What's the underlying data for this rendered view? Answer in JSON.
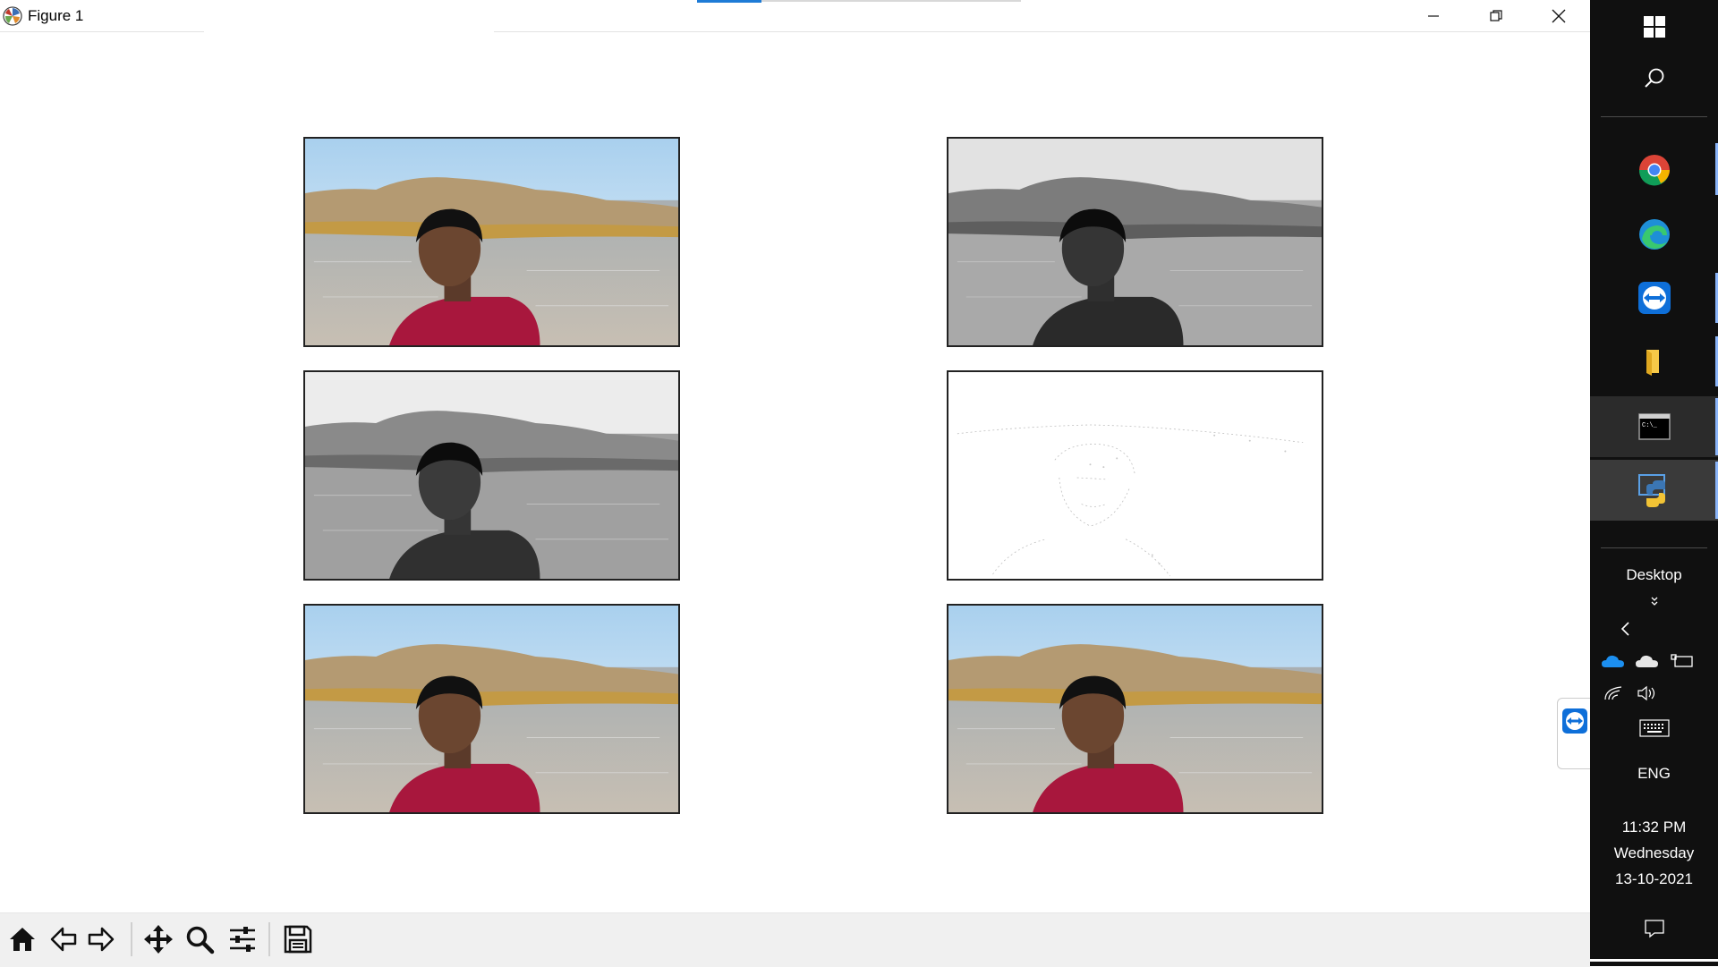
{
  "window": {
    "title": "Figure 1",
    "controls": [
      "minimize",
      "restore",
      "close"
    ]
  },
  "figure": {
    "panels": [
      {
        "name": "original-color-image",
        "style": "color"
      },
      {
        "name": "grayscale-image",
        "style": "gray"
      },
      {
        "name": "grayscale-image-2",
        "style": "gray2"
      },
      {
        "name": "edge-detection-image",
        "style": "edges"
      },
      {
        "name": "color-image-3",
        "style": "color"
      },
      {
        "name": "color-image-4",
        "style": "color"
      }
    ]
  },
  "toolbar": {
    "buttons": [
      "home-icon",
      "back-arrow-icon",
      "forward-arrow-icon",
      "pan-icon",
      "zoom-icon",
      "configure-subplots-icon",
      "save-icon"
    ]
  },
  "taskbar": {
    "desktop_label": "Desktop",
    "language": "ENG",
    "time": "11:32 PM",
    "day": "Wednesday",
    "date": "13-10-2021"
  },
  "colors": {
    "accent": "#1e7bd6",
    "taskbar_bg": "#101010",
    "toolbar_bg": "#f0f0f0"
  }
}
